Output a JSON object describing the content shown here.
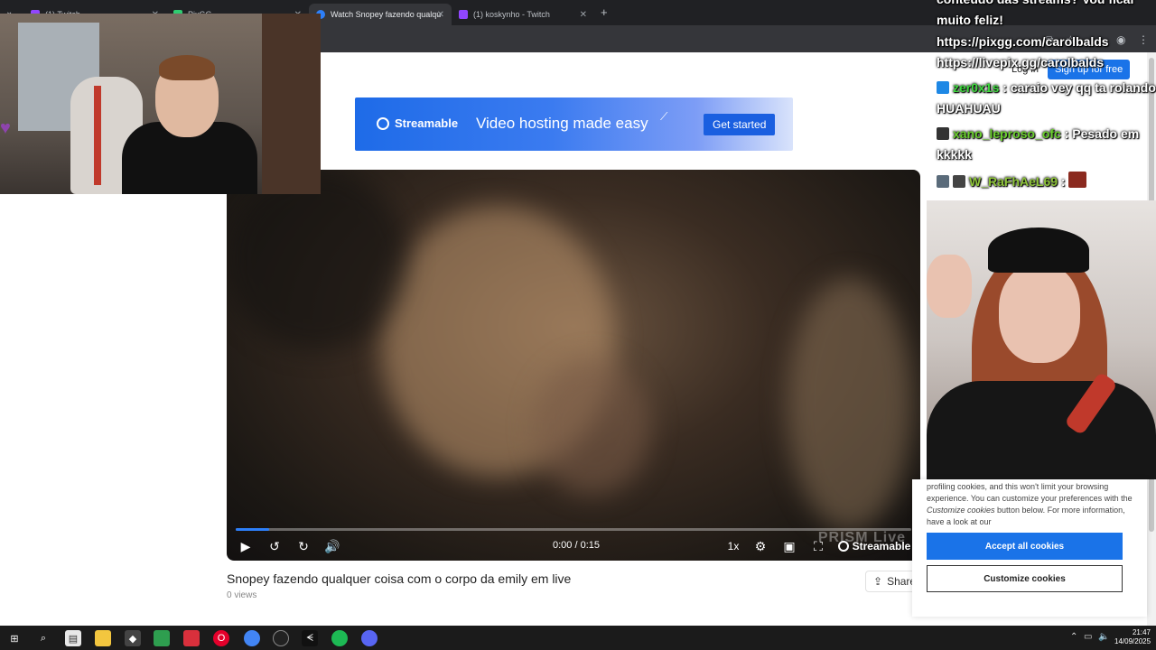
{
  "browser": {
    "tabs": [
      {
        "label": "(1) Twitch",
        "active": false
      },
      {
        "label": "PixGG",
        "active": false
      },
      {
        "label": "Watch Snopey fazendo qualqu",
        "active": true
      },
      {
        "label": "(1) koskynho - Twitch",
        "active": false
      }
    ],
    "new_tab": "+"
  },
  "header": {
    "login_label": "Log in",
    "signup_label": "Sign up for free"
  },
  "banner": {
    "brand": "Streamable",
    "tagline": "Video hosting made easy",
    "cta": "Get started"
  },
  "video": {
    "time": "0:00 / 0:15",
    "speed": "1x",
    "brand": "Streamable",
    "watermark": "PRISM Live",
    "progress": 0.05,
    "title": "Snopey fazendo qualquer coisa com o corpo da emily em live",
    "views": "0 views",
    "share": "Share"
  },
  "chat": {
    "messages": [
      {
        "user": "",
        "text": "conteúdo das streams? Vou ficar muito feliz!"
      },
      {
        "user": "",
        "text": "https://pixgg.com/carolbalds"
      },
      {
        "user": "",
        "text": "https://livepix.gg/carolbalds"
      },
      {
        "user": "zer0x1s",
        "text": ": caraio vey qq ta rolando HUAHUAU",
        "color": "#3fd93f"
      },
      {
        "user": "xano_leproso_ofc",
        "text": ": Pesado em kkkkk",
        "color": "#6bd12e"
      },
      {
        "user": "W_RaFhAeL69",
        "text": ":",
        "color": "#8ec43a"
      }
    ]
  },
  "cookies": {
    "text_before": "profiling cookies, and this won't limit your browsing experience. You can customize your preferences with the ",
    "emph": "Customize cookies",
    "text_after": " button below. For more information, have a look at our",
    "accept": "Accept all cookies",
    "customize": "Customize cookies"
  },
  "taskbar": {
    "time": "21:47",
    "date": "14/09/2025"
  },
  "colors": {
    "accent": "#1a73e8",
    "progress": "#2d7ff9"
  }
}
